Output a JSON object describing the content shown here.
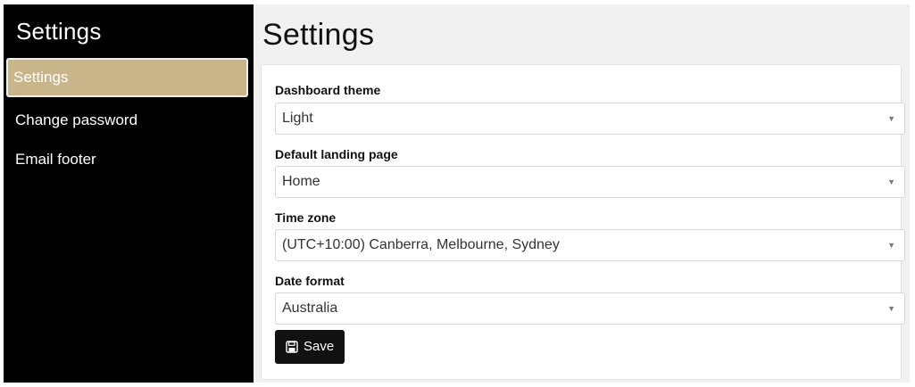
{
  "sidebar": {
    "title": "Settings",
    "items": [
      {
        "label": "Settings",
        "active": true
      },
      {
        "label": "Change password",
        "active": false
      },
      {
        "label": "Email footer",
        "active": false
      }
    ]
  },
  "main": {
    "title": "Settings",
    "fields": [
      {
        "label": "Dashboard theme",
        "value": "Light"
      },
      {
        "label": "Default landing page",
        "value": "Home"
      },
      {
        "label": "Time zone",
        "value": "(UTC+10:00) Canberra, Melbourne, Sydney"
      },
      {
        "label": "Date format",
        "value": "Australia"
      }
    ],
    "save_label": "Save",
    "save_icon": "floppy-disk-icon",
    "caret_icon": "caret-down-icon"
  },
  "colors": {
    "sidebar_bg": "#000000",
    "active_item_bg": "#c9b58a",
    "main_bg": "#f1f1f1",
    "button_bg": "#111111"
  }
}
